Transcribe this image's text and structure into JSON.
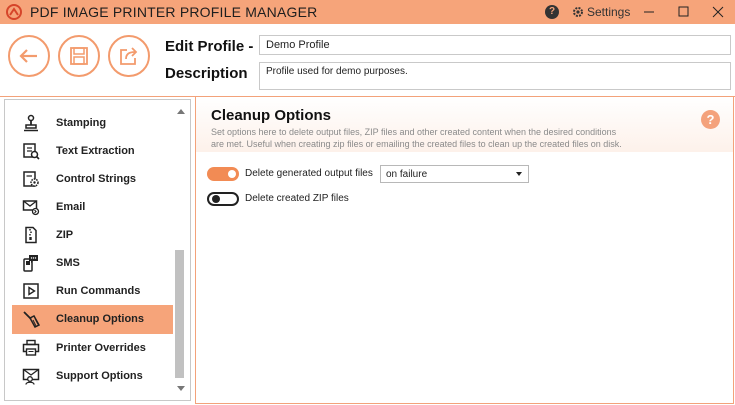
{
  "window": {
    "title": "PDF IMAGE PRINTER PROFILE MANAGER",
    "settings_label": "Settings",
    "accent_color": "#f6a47a"
  },
  "header": {
    "edit_profile_label": "Edit Profile -",
    "description_label": "Description",
    "profile_name": "Demo Profile",
    "profile_description": "Profile used for demo purposes."
  },
  "sidebar": {
    "items": [
      {
        "label": "Stamping",
        "icon": "stamp-icon"
      },
      {
        "label": "Text Extraction",
        "icon": "text-extraction-icon"
      },
      {
        "label": "Control Strings",
        "icon": "control-strings-icon"
      },
      {
        "label": "Email",
        "icon": "email-icon"
      },
      {
        "label": "ZIP",
        "icon": "zip-icon"
      },
      {
        "label": "SMS",
        "icon": "sms-icon"
      },
      {
        "label": "Run Commands",
        "icon": "run-commands-icon"
      },
      {
        "label": "Cleanup Options",
        "icon": "broom-icon",
        "selected": true
      },
      {
        "label": "Printer Overrides",
        "icon": "printer-icon"
      },
      {
        "label": "Support Options",
        "icon": "support-icon"
      }
    ]
  },
  "main": {
    "title": "Cleanup Options",
    "description": "Set options here to delete output files, ZIP files and other created content when the desired conditions are met. Useful when creating zip files or emailing the created files to clean up the created files on disk.",
    "help_glyph": "?",
    "options": [
      {
        "label": "Delete generated output files",
        "enabled": true,
        "select_value": "on failure"
      },
      {
        "label": "Delete created ZIP files",
        "enabled": false
      }
    ]
  }
}
